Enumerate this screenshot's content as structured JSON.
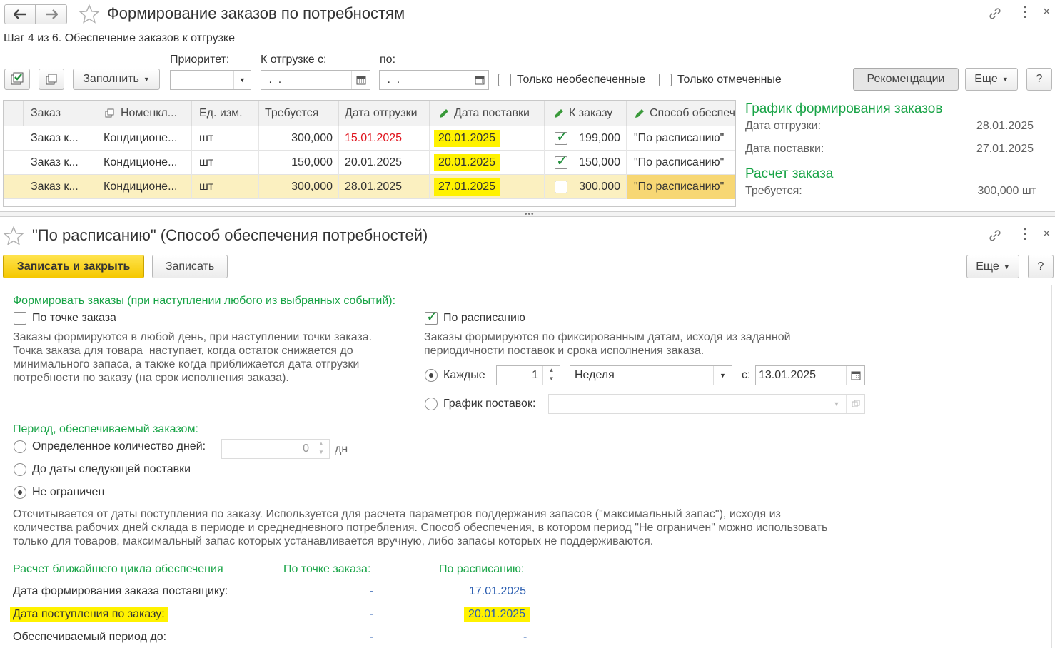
{
  "window1": {
    "title": "Формирование заказов по потребностям",
    "step": "Шаг 4 из 6. Обеспечение заказов к отгрузке",
    "toolbar": {
      "fill_label": "Заполнить",
      "priority_label": "Приоритет:",
      "priority_value": "",
      "ship_from_label": "К отгрузке с:",
      "ship_from_value": " .  .",
      "to_label": "по:",
      "to_value": " .  .",
      "only_unsecured_label": "Только необеспеченные",
      "only_marked_label": "Только отмеченные",
      "recommendations_label": "Рекомендации",
      "more_label": "Еще",
      "help_label": "?"
    },
    "table": {
      "columns": [
        "Заказ",
        "Номенкл...",
        "Ед. изм.",
        "Требуется",
        "Дата отгрузки",
        "Дата поставки",
        "К заказу",
        "Способ обеспеч"
      ],
      "rows": [
        {
          "order": "Заказ к...",
          "item": "Кондиционе...",
          "unit": "шт",
          "required": "300,000",
          "ship_date": "15.01.2025",
          "supply_date": "20.01.2025",
          "checked": true,
          "to_order": "199,000",
          "method": "\"По расписанию\""
        },
        {
          "order": "Заказ к...",
          "item": "Кондиционе...",
          "unit": "шт",
          "required": "150,000",
          "ship_date": "20.01.2025",
          "supply_date": "20.01.2025",
          "checked": true,
          "to_order": "150,000",
          "method": "\"По расписанию\""
        },
        {
          "order": "Заказ к...",
          "item": "Кондиционе...",
          "unit": "шт",
          "required": "300,000",
          "ship_date": "28.01.2025",
          "supply_date": "27.01.2025",
          "checked": false,
          "to_order": "300,000",
          "method": "\"По расписанию\""
        }
      ]
    },
    "side": {
      "schedule_title": "График формирования заказов",
      "ship_date_label": "Дата отгрузки:",
      "ship_date_value": "28.01.2025",
      "supply_date_label": "Дата поставки:",
      "supply_date_value": "27.01.2025",
      "calc_title": "Расчет заказа",
      "required_label": "Требуется:",
      "required_value": "300,000 шт"
    }
  },
  "window2": {
    "title": "\"По расписанию\" (Способ обеспечения потребностей)",
    "save_close_label": "Записать и закрыть",
    "save_label": "Записать",
    "more_label": "Еще",
    "help_label": "?",
    "form_orders_title": "Формировать заказы (при наступлении любого из выбранных событий):",
    "by_point_label": "По точке заказа",
    "by_point_desc": [
      "Заказы формируются в любой день, при наступлении точки заказа.",
      "Точка заказа для товара  наступает, когда остаток снижается до",
      "минимального запаса, а также когда приближается дата отгрузки",
      "потребности по заказу (на срок исполнения заказа)."
    ],
    "by_schedule_label": "По расписанию",
    "by_schedule_desc": [
      "Заказы формируются по фиксированным датам, исходя из заданной",
      "периодичности поставок и срока исполнения заказа."
    ],
    "every_label": "Каждые",
    "every_value": "1",
    "period_value": "Неделя",
    "from_label": "с:",
    "from_value": "13.01.2025",
    "supply_schedule_label": "График поставок:",
    "period_title": "Период, обеспечиваемый заказом:",
    "days_label": "Определенное количество дней:",
    "days_value": "0",
    "days_unit": "дн",
    "until_next_label": "До даты следующей поставки",
    "unlimited_label": "Не ограничен",
    "period_desc": [
      "Отсчитывается от даты поступления по заказу. Используется для расчета параметров поддержания запасов (\"максимальный запас\"), исходя из",
      "количества рабочих дней склада в периоде и среднедневного потребления. Способ обеспечения, в котором период \"Не ограничен\" можно использовать",
      "только для товаров, максимальный запас которых устанавливается вручную, либо запасы которых не поддерживаются."
    ],
    "cycle": {
      "title": "Расчет ближайшего цикла обеспечения",
      "col_point": "По точке заказа:",
      "col_schedule": "По расписанию:",
      "rows": [
        {
          "label": "Дата формирования заказа поставщику:",
          "point": "-",
          "schedule": "17.01.2025"
        },
        {
          "label": "Дата поступления по заказу:",
          "point": "-",
          "schedule": "20.01.2025"
        },
        {
          "label": "Обеспечиваемый период до:",
          "point": "-",
          "schedule": "-"
        }
      ]
    }
  }
}
